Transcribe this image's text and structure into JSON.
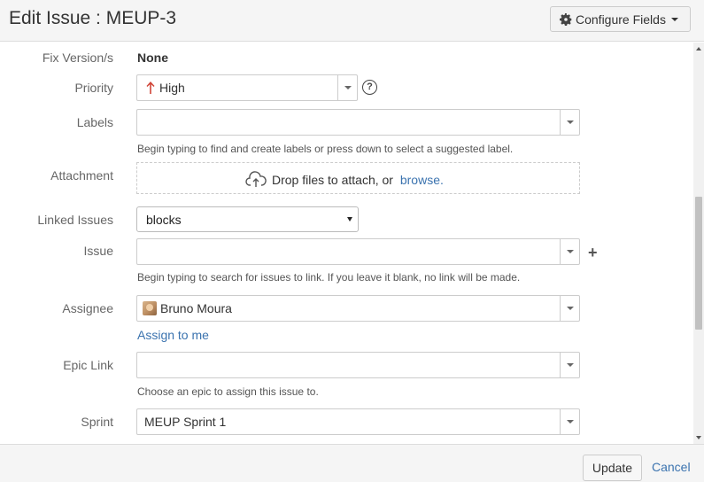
{
  "dialog": {
    "title": "Edit Issue : MEUP-3"
  },
  "toolbar": {
    "configure_fields_label": "Configure Fields"
  },
  "fields": {
    "fix_version": {
      "label": "Fix Version/s",
      "value": "None"
    },
    "priority": {
      "label": "Priority",
      "value": "High",
      "arrow_color": "#d04437"
    },
    "labels": {
      "label": "Labels",
      "value": "",
      "hint": "Begin typing to find and create labels or press down to select a suggested label."
    },
    "attachment": {
      "label": "Attachment",
      "drop_text": "Drop files to attach, or ",
      "browse_link": "browse."
    },
    "linked_issues": {
      "label": "Linked Issues",
      "selected": "blocks"
    },
    "issue": {
      "label": "Issue",
      "value": "",
      "hint": "Begin typing to search for issues to link. If you leave it blank, no link will be made."
    },
    "assignee": {
      "label": "Assignee",
      "value": "Bruno Moura",
      "assign_to_me": "Assign to me"
    },
    "epic_link": {
      "label": "Epic Link",
      "value": "",
      "hint": "Choose an epic to assign this issue to."
    },
    "sprint": {
      "label": "Sprint",
      "value": "MEUP Sprint 1"
    }
  },
  "icons": {
    "help": "?",
    "add": "+"
  },
  "footer": {
    "update_label": "Update",
    "cancel_label": "Cancel"
  },
  "colors": {
    "link": "#3b73af",
    "header_bg": "#f5f5f5"
  }
}
